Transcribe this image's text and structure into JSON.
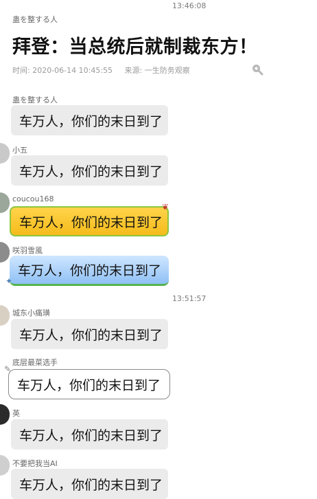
{
  "timestamps": {
    "first": "13:46:08",
    "second": "13:51:57"
  },
  "article_card": {
    "sender": "蛊を整する人",
    "title": "拜登：当总统后就制裁东方！",
    "meta_time_label": "时间:",
    "meta_time": "2020-06-14 10:45:55",
    "meta_source_label": "来源:",
    "meta_source": "一生防务观察",
    "zoom_icon": "zoom-in-icon"
  },
  "messages": [
    {
      "sender": "蛊を整する人",
      "text": "车万人，你们的末日到了",
      "style": "gray"
    },
    {
      "sender": "小五",
      "text": "车万人，你们的末日到了",
      "style": "gray"
    },
    {
      "sender": "coucou168",
      "text": "车万人，你们的末日到了",
      "style": "yellow"
    },
    {
      "sender": "咲羽雪風",
      "text": "车万人，你们的末日到了",
      "style": "blue"
    },
    {
      "sender": "城东小痛璜",
      "text": "车万人，你们的末日到了",
      "style": "gray"
    },
    {
      "sender": "底层最菜选手",
      "text": "车万人，你们的末日到了",
      "style": "outline"
    },
    {
      "sender": "英",
      "text": "车万人，你们的末日到了",
      "style": "gray"
    },
    {
      "sender": "不要把我当AI",
      "text": "车万人，你们的末日到了",
      "style": "gray"
    }
  ],
  "colors": {
    "bubble_gray": "#ebebeb",
    "bubble_yellow": "#f5bb1b",
    "bubble_blue": "#8fc0f5",
    "accent_green": "#53b34d"
  }
}
